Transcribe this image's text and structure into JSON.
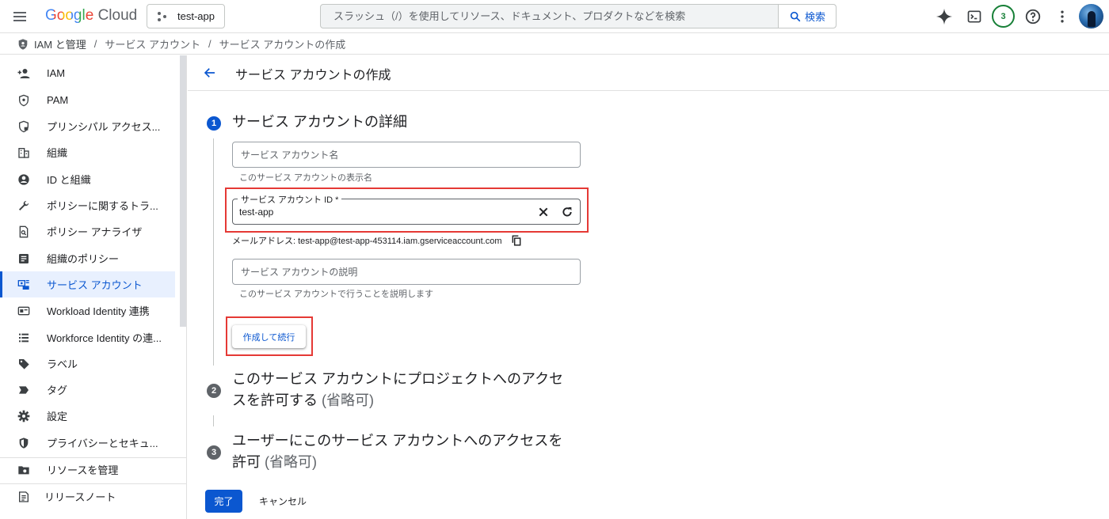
{
  "topbar": {
    "logo_google": "Google",
    "logo_cloud": "Cloud",
    "project_name": "test-app",
    "search_placeholder": "スラッシュ（/）を使用してリソース、ドキュメント、プロダクトなどを検索",
    "search_button": "検索",
    "notifications_count": "3"
  },
  "breadcrumb": {
    "items": [
      "IAM と管理",
      "サービス アカウント",
      "サービス アカウントの作成"
    ],
    "separator": "/"
  },
  "sidebar": {
    "items": [
      {
        "label": "IAM",
        "icon": "add-person-icon"
      },
      {
        "label": "PAM",
        "icon": "shield-icon"
      },
      {
        "label": "プリンシパル アクセス...",
        "icon": "shield-lock-icon"
      },
      {
        "label": "組織",
        "icon": "building-icon"
      },
      {
        "label": "ID と組織",
        "icon": "account-circle-icon"
      },
      {
        "label": "ポリシーに関するトラ...",
        "icon": "wrench-icon"
      },
      {
        "label": "ポリシー アナライザ",
        "icon": "document-search-icon"
      },
      {
        "label": "組織のポリシー",
        "icon": "article-icon"
      },
      {
        "label": "サービス アカウント",
        "icon": "service-account-icon",
        "active": true
      },
      {
        "label": "Workload Identity 連携",
        "icon": "id-card-icon"
      },
      {
        "label": "Workforce Identity の連...",
        "icon": "list-icon"
      },
      {
        "label": "ラベル",
        "icon": "tag-icon"
      },
      {
        "label": "タグ",
        "icon": "label-arrow-icon"
      },
      {
        "label": "設定",
        "icon": "gear-icon"
      },
      {
        "label": "プライバシーとセキュ...",
        "icon": "privacy-shield-icon"
      }
    ],
    "manage_resources": "リソースを管理",
    "release_notes": "リリースノート"
  },
  "page": {
    "title": "サービス アカウントの作成"
  },
  "step1": {
    "number": "1",
    "title": "サービス アカウントの詳細",
    "name_placeholder": "サービス アカウント名",
    "name_hint": "このサービス アカウントの表示名",
    "id_label": "サービス アカウント ID *",
    "id_value": "test-app",
    "email_line": "メールアドレス: test-app@test-app-453114.iam.gserviceaccount.com",
    "description_placeholder": "サービス アカウントの説明",
    "description_hint": "このサービス アカウントで行うことを説明します",
    "create_button": "作成して続行"
  },
  "step2": {
    "number": "2",
    "title_line1": "このサービス アカウントにプロジェクトへのアクセ",
    "title_line2": "スを許可する",
    "optional": "(省略可)"
  },
  "step3": {
    "number": "3",
    "title_line1": "ユーザーにこのサービス アカウントへのアクセスを",
    "title_line2": "許可",
    "optional": "(省略可)"
  },
  "actions": {
    "done": "完了",
    "cancel": "キャンセル"
  },
  "colors": {
    "accent": "#0b57d0",
    "highlight": "#e53935",
    "badge": "#188038"
  }
}
